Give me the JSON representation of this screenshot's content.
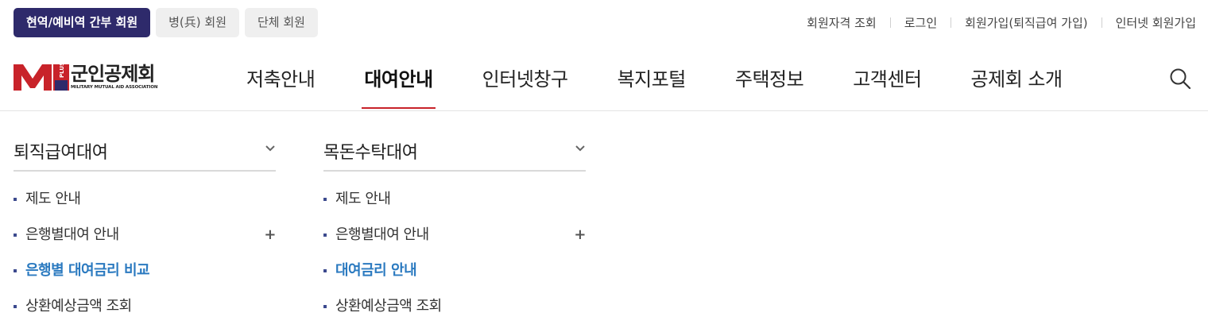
{
  "member_tabs": [
    {
      "label": "현역/예비역 간부 회원",
      "active": true
    },
    {
      "label": "병(兵) 회원",
      "active": false
    },
    {
      "label": "단체 회원",
      "active": false
    }
  ],
  "util_links": [
    "회원자격 조회",
    "로그인",
    "회원가입(퇴직급여 가입)",
    "인터넷 회원가입"
  ],
  "logo": {
    "mark_text": "PLUS",
    "name": "군인공제회",
    "english": "MILITARY MUTUAL AID ASSOCIATION"
  },
  "gnb": [
    {
      "label": "저축안내",
      "active": false
    },
    {
      "label": "대여안내",
      "active": true
    },
    {
      "label": "인터넷창구",
      "active": false
    },
    {
      "label": "복지포털",
      "active": false
    },
    {
      "label": "주택정보",
      "active": false
    },
    {
      "label": "고객센터",
      "active": false
    },
    {
      "label": "공제회 소개",
      "active": false
    }
  ],
  "search_icon": "search-icon",
  "submenu": [
    {
      "title": "퇴직급여대여",
      "items": [
        {
          "label": "제도 안내"
        },
        {
          "label": "은행별대여 안내",
          "expand": "+"
        },
        {
          "label": "은행별 대여금리 비교",
          "current": true
        },
        {
          "label": "상환예상금액 조회"
        }
      ]
    },
    {
      "title": "목돈수탁대여",
      "items": [
        {
          "label": "제도 안내"
        },
        {
          "label": "은행별대여 안내",
          "expand": "+"
        },
        {
          "label": "대여금리 안내",
          "current": true
        },
        {
          "label": "상환예상금액 조회"
        }
      ]
    }
  ],
  "colors": {
    "primary": "#2e2a6b",
    "brand_red": "#c8232a",
    "current_link": "#2b7ac0"
  }
}
